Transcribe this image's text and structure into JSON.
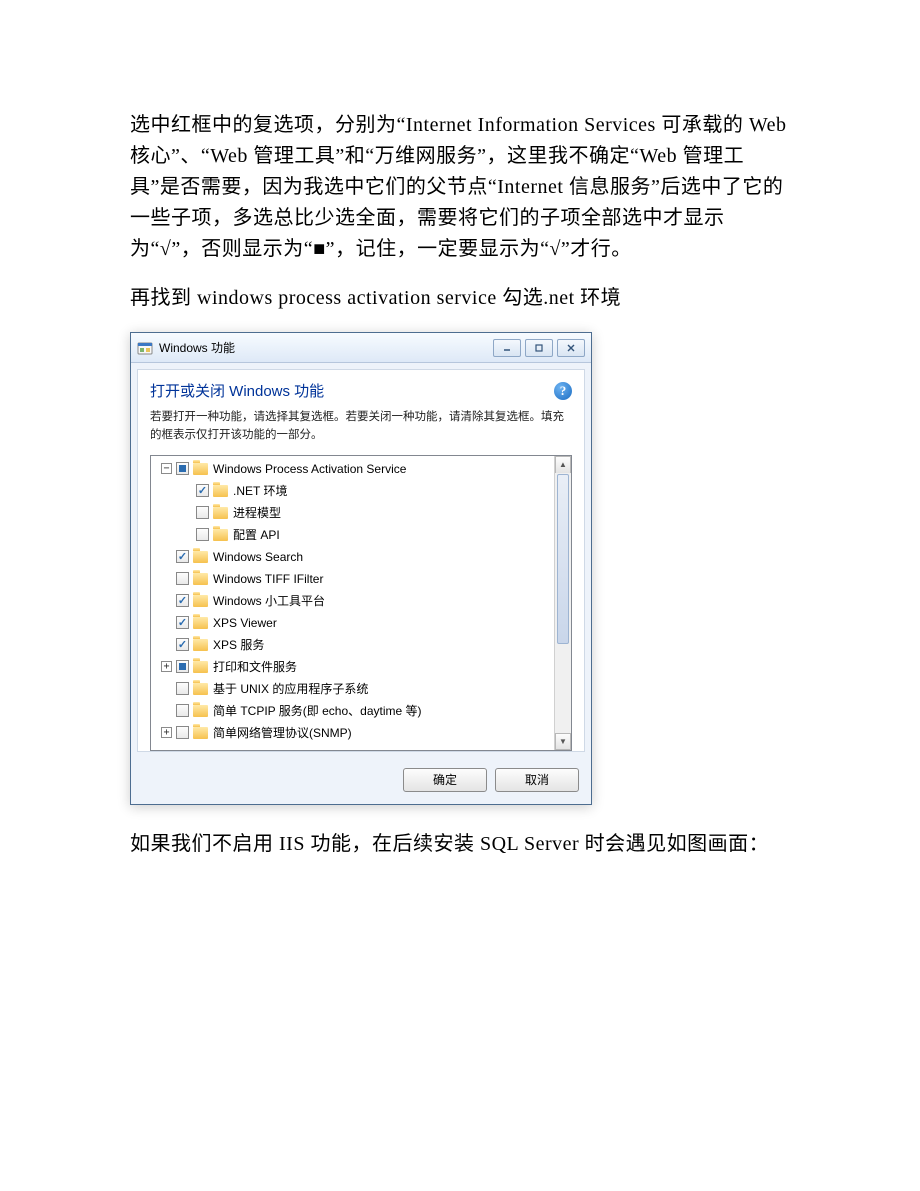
{
  "paragraphs": {
    "p1": "选中红框中的复选项，分别为“Internet Information Services 可承载的 Web 核心”、“Web 管理工具”和“万维网服务”，这里我不确定“Web 管理工具”是否需要，因为我选中它们的父节点“Internet 信息服务”后选中了它的一些子项，多选总比少选全面，需要将它们的子项全部选中才显示为“√”，否则显示为“■”，记住，一定要显示为“√”才行。",
    "p2": "再找到 windows process activation service 勾选.net 环境",
    "p3": "如果我们不启用 IIS 功能，在后续安装 SQL Server 时会遇见如图画面："
  },
  "dialog": {
    "title": "Windows 功能",
    "heading": "打开或关闭 Windows 功能",
    "description": "若要打开一种功能，请选择其复选框。若要关闭一种功能，请清除其复选框。填充的框表示仅打开该功能的一部分。",
    "buttons": {
      "ok": "确定",
      "cancel": "取消"
    }
  },
  "tree": [
    {
      "indent": 0,
      "expander": "-",
      "state": "partial",
      "label": "Windows Process Activation Service"
    },
    {
      "indent": 1,
      "expander": "",
      "state": "checked",
      "label": ".NET 环境"
    },
    {
      "indent": 1,
      "expander": "",
      "state": "empty",
      "label": "进程模型"
    },
    {
      "indent": 1,
      "expander": "",
      "state": "empty",
      "label": "配置 API"
    },
    {
      "indent": 0,
      "expander": "",
      "state": "checked",
      "label": "Windows Search"
    },
    {
      "indent": 0,
      "expander": "",
      "state": "empty",
      "label": "Windows TIFF IFilter"
    },
    {
      "indent": 0,
      "expander": "",
      "state": "checked",
      "label": "Windows 小工具平台"
    },
    {
      "indent": 0,
      "expander": "",
      "state": "checked",
      "label": "XPS Viewer"
    },
    {
      "indent": 0,
      "expander": "",
      "state": "checked",
      "label": "XPS 服务"
    },
    {
      "indent": 0,
      "expander": "+",
      "state": "partial",
      "label": "打印和文件服务"
    },
    {
      "indent": 0,
      "expander": "",
      "state": "empty",
      "label": "基于 UNIX 的应用程序子系统"
    },
    {
      "indent": 0,
      "expander": "",
      "state": "empty",
      "label": "简单 TCPIP 服务(即 echo、daytime 等)"
    },
    {
      "indent": 0,
      "expander": "+",
      "state": "empty",
      "label": "简单网络管理协议(SNMP)"
    }
  ]
}
